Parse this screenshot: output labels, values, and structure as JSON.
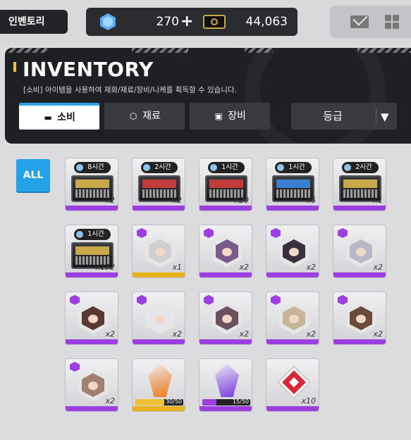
{
  "header": {
    "screen_title": "인벤토리",
    "gems": "270",
    "gems_plus": "+",
    "credits": "44,063",
    "icons": [
      "gem-icon",
      "credit-icon",
      "mail-icon",
      "menu-grid-icon"
    ]
  },
  "panel": {
    "title": "INVENTORY",
    "description": "[소비] 아이템을 사용하여 재화/재료/장비/니케를 획득할 수 있습니다.",
    "tabs": [
      {
        "label": "소비",
        "icon": "consumable-icon",
        "active": true
      },
      {
        "label": "재료",
        "icon": "material-icon",
        "active": false
      },
      {
        "label": "장비",
        "icon": "equipment-icon",
        "active": false
      }
    ],
    "sort_label": "등급",
    "sort_arrow": "▼"
  },
  "filter": {
    "all_label": "ALL"
  },
  "items": [
    {
      "type": "crate",
      "timer": "8시간",
      "qty": "x2",
      "lid_color": "#c9a84a",
      "rarity_color": "#9b3fe0"
    },
    {
      "type": "crate",
      "timer": "2시간",
      "qty": "x2",
      "lid_color": "#c23b3b",
      "rarity_color": "#9b3fe0"
    },
    {
      "type": "crate",
      "timer": "1시간",
      "qty": "x20",
      "lid_color": "#c23b3b",
      "rarity_color": "#9b3fe0"
    },
    {
      "type": "crate",
      "timer": "1시간",
      "qty": "x6",
      "lid_color": "#3a7fd0",
      "rarity_color": "#9b3fe0"
    },
    {
      "type": "crate",
      "timer": "2시간",
      "qty": "x1",
      "lid_color": "#c9a84a",
      "rarity_color": "#9b3fe0"
    },
    {
      "type": "crate",
      "timer": "1시간",
      "qty": "x132",
      "lid_color": "#c9a84a",
      "rarity_color": "#9b3fe0"
    },
    {
      "type": "char",
      "qty": "x1",
      "rarity_color": "#e8b21c",
      "badge_color": "#9b3fe0",
      "face_color": "#cfcfcf"
    },
    {
      "type": "char",
      "qty": "x2",
      "rarity_color": "#9b3fe0",
      "badge_color": "#9b3fe0",
      "face_color": "#7a5a8a"
    },
    {
      "type": "char",
      "qty": "x2",
      "rarity_color": "#9b3fe0",
      "badge_color": "#9b3fe0",
      "face_color": "#3b3040"
    },
    {
      "type": "char",
      "qty": "x2",
      "rarity_color": "#9b3fe0",
      "badge_color": "#9b3fe0",
      "face_color": "#b8b8c8"
    },
    {
      "type": "char",
      "qty": "x2",
      "rarity_color": "#9b3fe0",
      "badge_color": "#9b3fe0",
      "face_color": "#5a3a30"
    },
    {
      "type": "char",
      "qty": "x2",
      "rarity_color": "#9b3fe0",
      "badge_color": "#9b3fe0",
      "face_color": "#e4e4ea"
    },
    {
      "type": "char",
      "qty": "x2",
      "rarity_color": "#9b3fe0",
      "badge_color": "#9b3fe0",
      "face_color": "#6b5060"
    },
    {
      "type": "char",
      "qty": "x2",
      "rarity_color": "#9b3fe0",
      "badge_color": "#9b3fe0",
      "face_color": "#c8b49a"
    },
    {
      "type": "char",
      "qty": "x2",
      "rarity_color": "#9b3fe0",
      "badge_color": "#9b3fe0",
      "face_color": "#6a4a3a"
    },
    {
      "type": "char",
      "qty": "x2",
      "rarity_color": "#9b3fe0",
      "badge_color": "#9b3fe0",
      "face_color": "#a08070"
    },
    {
      "type": "crystal",
      "gauge": "30/50",
      "progress": 0.6,
      "crystal_color": "#f07a1a",
      "gauge_color": "#f0c23a",
      "rarity_color": "#e8b21c"
    },
    {
      "type": "crystal",
      "gauge": "15/50",
      "progress": 0.3,
      "crystal_color": "#7a3ae0",
      "gauge_color": "#9b3fe0",
      "rarity_color": "#9b3fe0"
    },
    {
      "type": "box",
      "qty": "x10",
      "rarity_color": "#9b3fe0"
    }
  ]
}
